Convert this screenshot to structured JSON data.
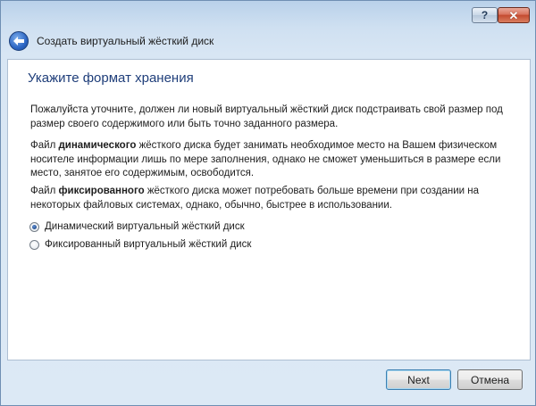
{
  "window": {
    "title": "Создать виртуальный жёсткий диск",
    "help_label": "?",
    "close_label": "✕"
  },
  "page": {
    "heading": "Укажите формат хранения",
    "p1": "Пожалуйста уточните, должен ли новый виртуальный жёсткий диск подстраивать свой размер под размер своего содержимого или быть точно заданного размера.",
    "p2_prefix": "Файл ",
    "p2_bold": "динамического",
    "p2_suffix": " жёсткого диска будет занимать необходимое место на Вашем физическом носителе информации лишь по мере заполнения, однако не сможет уменьшиться в размере если место, занятое его содержимым, освободится.",
    "p3_prefix": "Файл ",
    "p3_bold": "фиксированного",
    "p3_suffix": " жёсткого диска может потребовать больше времени при создании на некоторых файловых системах, однако, обычно, быстрее в использовании.",
    "options": [
      {
        "label": "Динамический виртуальный жёсткий диск",
        "selected": true
      },
      {
        "label": "Фиксированный виртуальный жёсткий диск",
        "selected": false
      }
    ]
  },
  "buttons": {
    "next": "Next",
    "cancel": "Отмена"
  },
  "icons": {
    "back": "back-arrow-icon",
    "help": "help-icon",
    "close": "close-icon"
  }
}
